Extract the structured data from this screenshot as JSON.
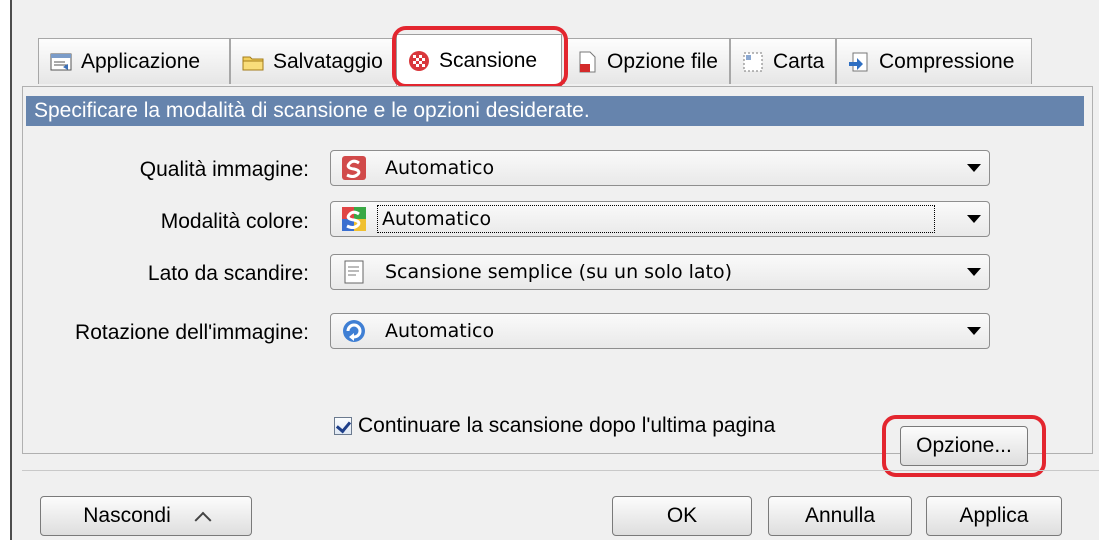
{
  "tabs": [
    {
      "label": "Applicazione",
      "icon": "application-icon"
    },
    {
      "label": "Salvataggio",
      "icon": "folder-icon"
    },
    {
      "label": "Scansione",
      "icon": "scan-icon"
    },
    {
      "label": "Opzione file",
      "icon": "file-icon"
    },
    {
      "label": "Carta",
      "icon": "paper-icon"
    },
    {
      "label": "Compressione",
      "icon": "compression-icon"
    }
  ],
  "active_tab": "Scansione",
  "header": {
    "text": "Specificare la modalità di scansione e le opzioni desiderate."
  },
  "fields": {
    "image_quality": {
      "label": "Qualità immagine:",
      "value": "Automatico"
    },
    "color_mode": {
      "label": "Modalità colore:",
      "value": "Automatico"
    },
    "scan_side": {
      "label": "Lato da scandire:",
      "value": "Scansione semplice (su un solo lato)"
    },
    "rotation": {
      "label": "Rotazione dell'immagine:",
      "value": "Automatico"
    }
  },
  "continue_scan": {
    "label": "Continuare la scansione dopo l'ultima pagina",
    "checked": true
  },
  "buttons": {
    "option": "Opzione...",
    "hide": "Nascondi",
    "ok": "OK",
    "cancel": "Annulla",
    "apply": "Applica"
  },
  "colors": {
    "header_bg": "#6684ad",
    "highlight": "#e3262f",
    "window_bg": "#f0f0f0"
  }
}
